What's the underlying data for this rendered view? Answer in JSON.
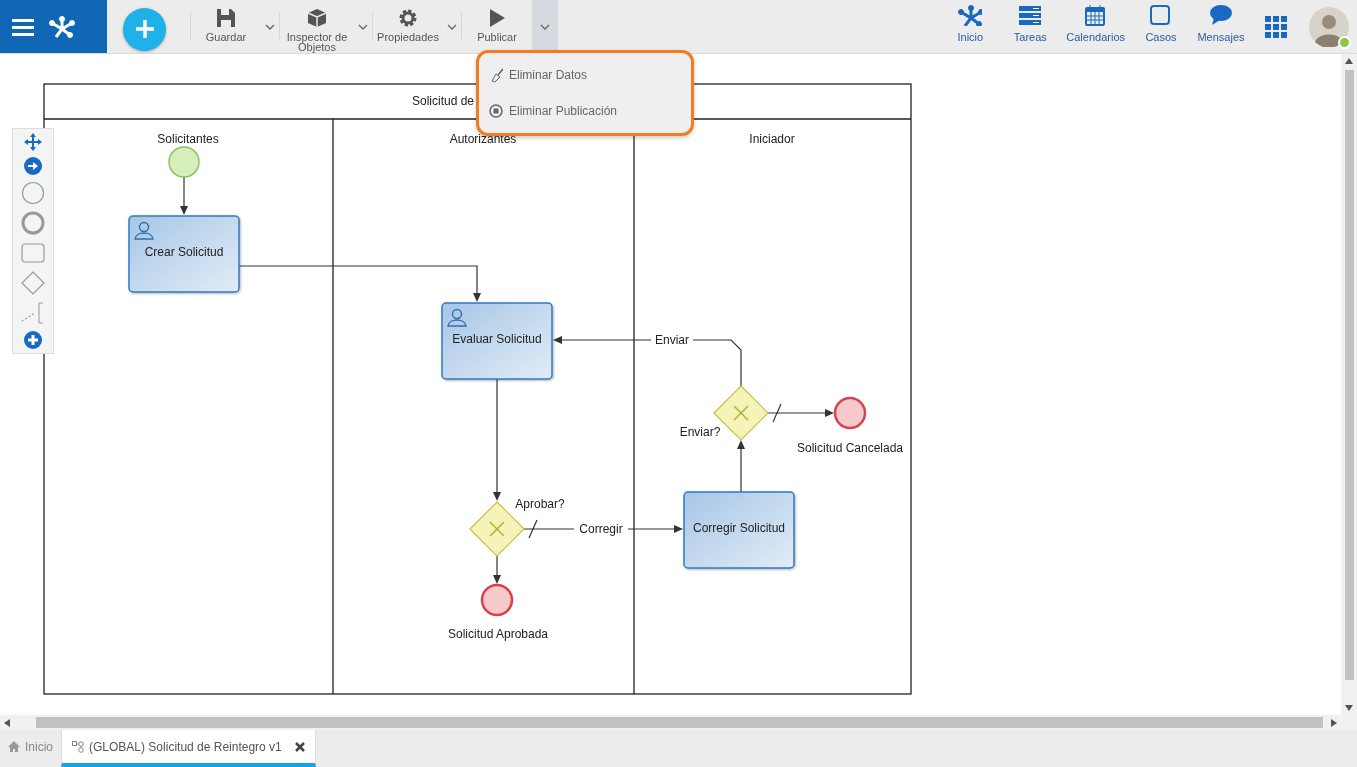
{
  "toolbar": {
    "buttons": [
      {
        "label": "Guardar",
        "kind": "save",
        "has_menu": true
      },
      {
        "label": "Inspector de Objetos",
        "kind": "inspector",
        "has_menu": true
      },
      {
        "label": "Propiedades",
        "kind": "properties",
        "has_menu": true
      },
      {
        "label": "Publicar",
        "kind": "publish",
        "has_menu": false
      }
    ]
  },
  "publish_menu": {
    "expanded": true,
    "items": [
      {
        "label": "Eliminar Datos",
        "kind": "clear"
      },
      {
        "label": "Eliminar Publicación",
        "kind": "unpublish"
      }
    ]
  },
  "nav": [
    {
      "label": "Inicio",
      "kind": "home"
    },
    {
      "label": "Tareas",
      "kind": "tasks"
    },
    {
      "label": "Calendarios",
      "kind": "calendar"
    },
    {
      "label": "Casos",
      "kind": "cases"
    },
    {
      "label": "Mensajes",
      "kind": "messages"
    }
  ],
  "user": {
    "online": true
  },
  "diagram": {
    "pool_title": "Solicitud de",
    "lanes": [
      "Solicitantes",
      "Autorizantes",
      "Iniciador"
    ],
    "nodes": [
      {
        "kind": "start"
      },
      {
        "kind": "user_task",
        "label": "Crear Solicitud"
      },
      {
        "kind": "user_task",
        "label": "Evaluar Solicitud"
      },
      {
        "kind": "gateway",
        "label": "Enviar?"
      },
      {
        "kind": "end",
        "label": "Solicitud Cancelada"
      },
      {
        "kind": "task",
        "label": "Corregir Solicitud"
      },
      {
        "kind": "gateway",
        "label": "Aprobar?"
      },
      {
        "kind": "end",
        "label": "Solicitud Aprobada"
      }
    ],
    "flows": [
      {
        "label": "Corregir"
      },
      {
        "label": "Enviar"
      }
    ]
  },
  "tabs": [
    {
      "label": "Inicio",
      "kind": "home",
      "selected": false,
      "closable": false
    },
    {
      "label": "(GLOBAL) Solicitud de Reintegro v1",
      "kind": "process",
      "selected": true,
      "closable": true
    }
  ]
}
